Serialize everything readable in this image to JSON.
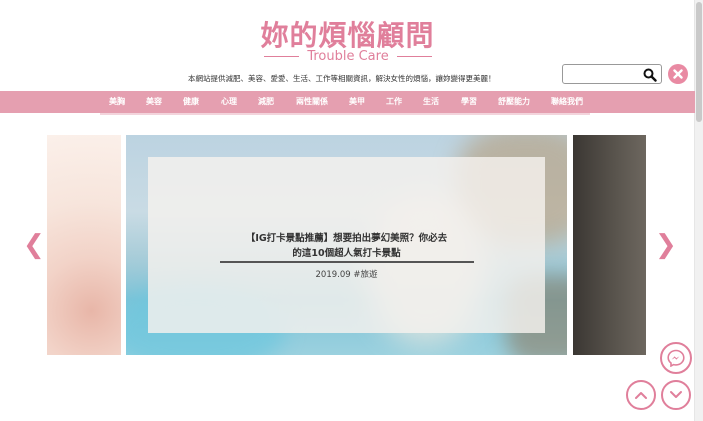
{
  "site": {
    "title": "妳的煩惱顧問",
    "subtitle": "Trouble Care",
    "tagline": "本網站提供減肥、美容、愛愛、生活、工作等相關資訊，解決女性的煩惱，讓妳變得更美麗！"
  },
  "search": {
    "value": "",
    "placeholder": ""
  },
  "nav": {
    "items": [
      {
        "label": "美胸"
      },
      {
        "label": "美容"
      },
      {
        "label": "健康"
      },
      {
        "label": "心理"
      },
      {
        "label": "減肥"
      },
      {
        "label": "兩性關係"
      },
      {
        "label": "美甲"
      },
      {
        "label": "工作"
      },
      {
        "label": "生活"
      },
      {
        "label": "學習"
      },
      {
        "label": "舒壓能力"
      },
      {
        "label": "聯絡我們"
      }
    ]
  },
  "slider": {
    "title_line1": "【IG打卡景點推薦】想要拍出夢幻美照？你必去",
    "title_line2": "的這10個超人氣打卡景點",
    "date": "2019.09",
    "tag": "#旅遊",
    "prev_glyph": "❮",
    "next_glyph": "❯"
  },
  "icons": {
    "search": "search-icon",
    "close": "close-icon",
    "messenger": "messenger-icon",
    "scroll_up": "chevron-up-icon",
    "scroll_down": "chevron-down-icon"
  },
  "colors": {
    "accent": "#e07f9b",
    "navbar": "#e59fb0"
  }
}
